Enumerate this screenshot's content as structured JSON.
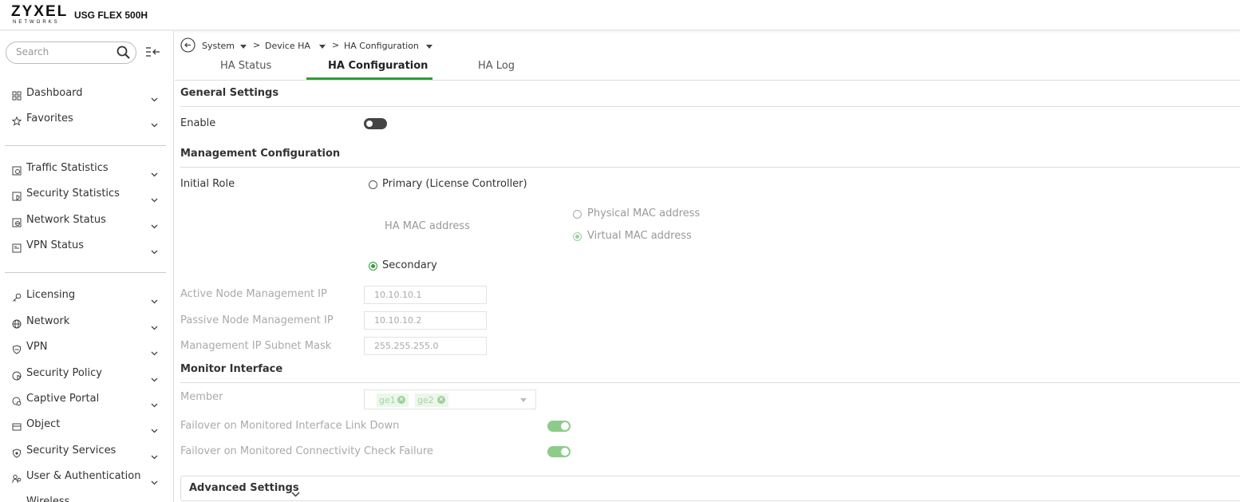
{
  "header": {
    "brand": "ZYXEL",
    "brand_sub": "NETWORKS",
    "model": "USG FLEX 500H"
  },
  "sidebar": {
    "search_placeholder": "Search",
    "items": [
      {
        "label": "Dashboard",
        "icon": "dashboard-icon"
      },
      {
        "label": "Favorites",
        "icon": "star-icon"
      },
      {
        "label": "Traffic Statistics",
        "icon": "traffic-statistics-icon"
      },
      {
        "label": "Security Statistics",
        "icon": "security-statistics-icon"
      },
      {
        "label": "Network Status",
        "icon": "network-status-icon"
      },
      {
        "label": "VPN Status",
        "icon": "vpn-status-icon"
      },
      {
        "label": "Licensing",
        "icon": "key-icon"
      },
      {
        "label": "Network",
        "icon": "globe-icon"
      },
      {
        "label": "VPN",
        "icon": "shield-icon"
      },
      {
        "label": "Security Policy",
        "icon": "security-policy-icon"
      },
      {
        "label": "Captive Portal",
        "icon": "captive-portal-icon"
      },
      {
        "label": "Object",
        "icon": "object-icon"
      },
      {
        "label": "Security Services",
        "icon": "security-services-icon"
      },
      {
        "label": "User & Authentication",
        "icon": "users-icon"
      },
      {
        "label": "Wireless",
        "icon": "wireless-icon"
      }
    ]
  },
  "breadcrumb": {
    "items": [
      "System",
      "Device HA",
      "HA Configuration"
    ]
  },
  "tabs": [
    {
      "label": "HA Status",
      "active": false
    },
    {
      "label": "HA Configuration",
      "active": true
    },
    {
      "label": "HA Log",
      "active": false
    }
  ],
  "general": {
    "title": "General Settings",
    "enable_label": "Enable",
    "enabled": false
  },
  "management": {
    "title": "Management Configuration",
    "initial_role_label": "Initial Role",
    "role_primary": "Primary (License Controller)",
    "ha_mac_label": "HA MAC address",
    "mac_physical": "Physical MAC address",
    "mac_virtual": "Virtual MAC address",
    "selected_mac": "Virtual MAC address",
    "role_secondary": "Secondary",
    "selected_role": "Secondary",
    "active_ip_label": "Active Node Management IP",
    "active_ip": "10.10.10.1",
    "passive_ip_label": "Passive Node Management IP",
    "passive_ip": "10.10.10.2",
    "subnet_label": "Management IP Subnet Mask",
    "subnet": "255.255.255.0"
  },
  "monitor": {
    "title": "Monitor Interface",
    "member_label": "Member",
    "members": [
      "ge1",
      "ge2"
    ],
    "failover_link_label": "Failover on Monitored Interface Link Down",
    "failover_link": true,
    "failover_check_label": "Failover on Monitored Connectivity Check Failure",
    "failover_check": true
  },
  "advanced": {
    "label": "Advanced Settings"
  },
  "colors": {
    "accent": "#2e9e3a",
    "toggle_off": "#444444",
    "toggle_on_disabled": "#8ccc8a"
  }
}
